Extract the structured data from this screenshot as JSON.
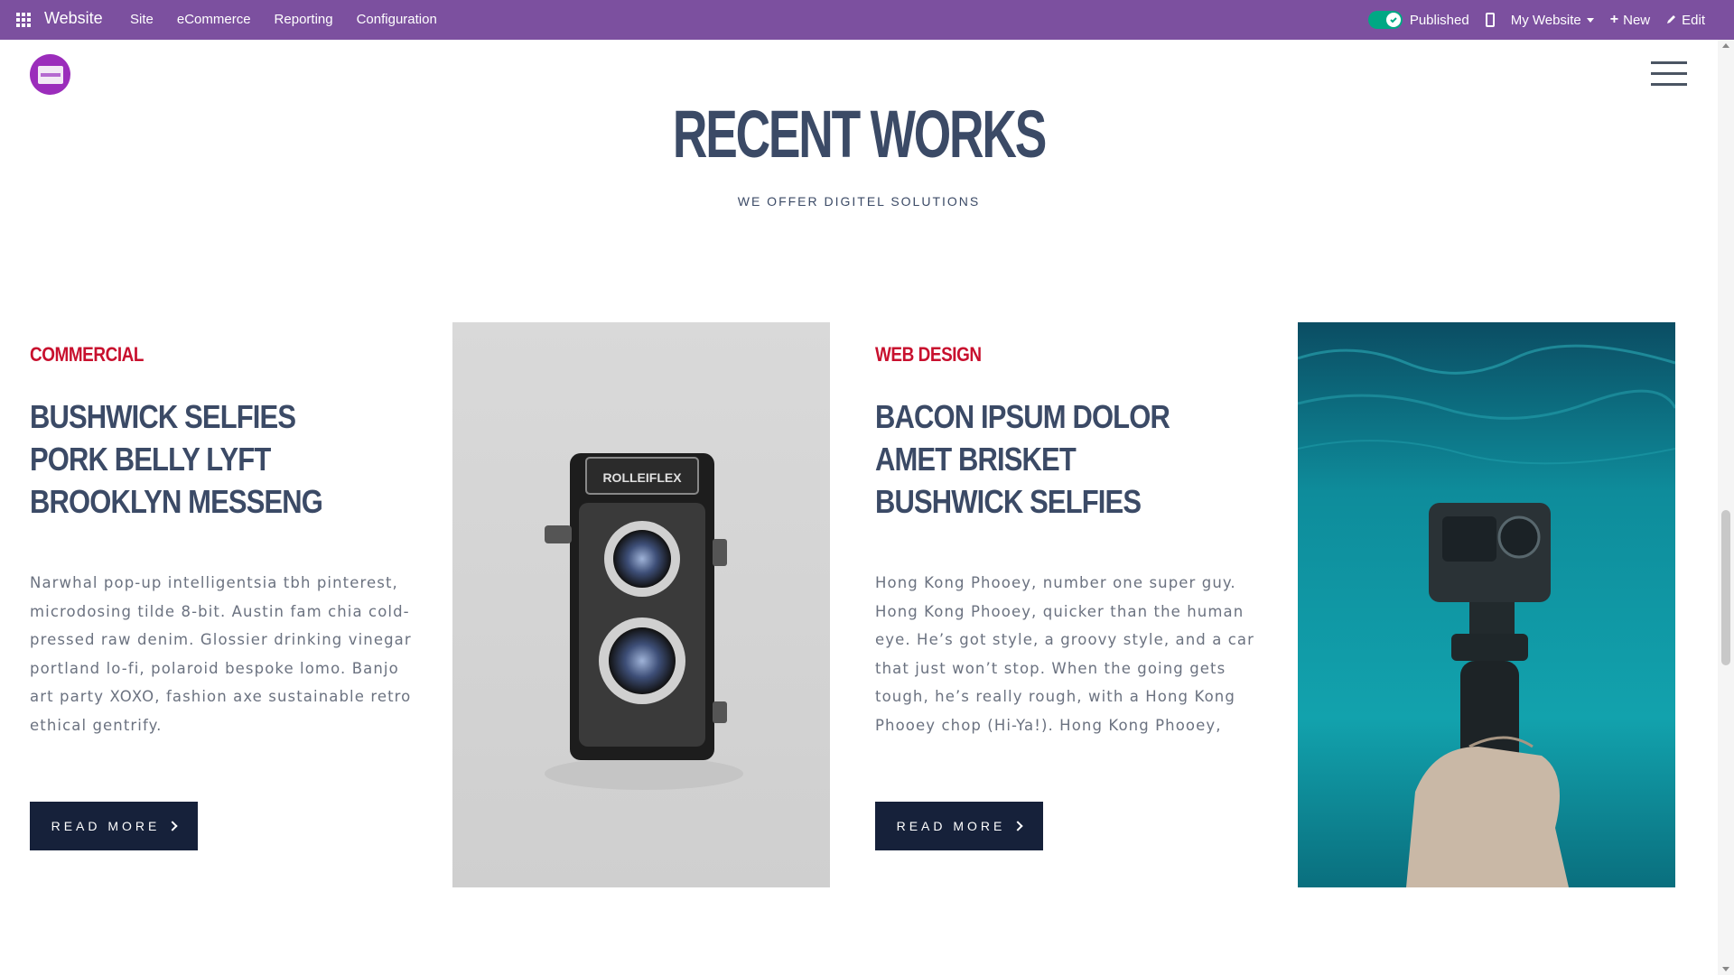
{
  "topbar": {
    "brand": "Website",
    "menu": [
      "Site",
      "eCommerce",
      "Reporting",
      "Configuration"
    ],
    "published_label": "Published",
    "website_label": "My Website",
    "new_label": "New",
    "edit_label": "Edit",
    "colors": {
      "bar": "#7c509f",
      "toggle": "#00a884"
    }
  },
  "site": {
    "section_title": "RECENT WORKS",
    "section_subtitle": "WE OFFER DIGITEL SOLUTIONS"
  },
  "cards": [
    {
      "category": "COMMERCIAL",
      "headline": [
        "BUSHWICK SELFIES",
        "PORK BELLY LYFT",
        "BROOKLYN MESSENG"
      ],
      "body": "Narwhal pop-up intelligentsia tbh pinterest, microdosing tilde 8-bit. Austin fam chia cold-pressed raw denim. Glossier drinking vinegar portland lo-fi, polaroid bespoke lomo. Banjo art party XOXO, fashion axe sustainable retro ethical gentrify.",
      "button": "READ MORE",
      "image": "camera-photo"
    },
    {
      "category": "WEB DESIGN",
      "headline": [
        "BACON IPSUM DOLOR",
        "AMET BRISKET",
        "BUSHWICK SELFIES"
      ],
      "body": "Hong Kong Phooey, number one super guy. Hong Kong Phooey, quicker than the human eye. He’s got style, a groovy style, and a car that just won’t stop. When the going gets tough, he’s really rough, with a Hong Kong Phooey chop (Hi-Ya!). Hong Kong Phooey,",
      "button": "READ MORE",
      "image": "underwater-camera-photo"
    }
  ],
  "images": {
    "camera_label": "ROLLEIFLEX"
  },
  "colors": {
    "heading": "#3b4a66",
    "category": "#c8102e",
    "button_bg": "#16213a"
  }
}
